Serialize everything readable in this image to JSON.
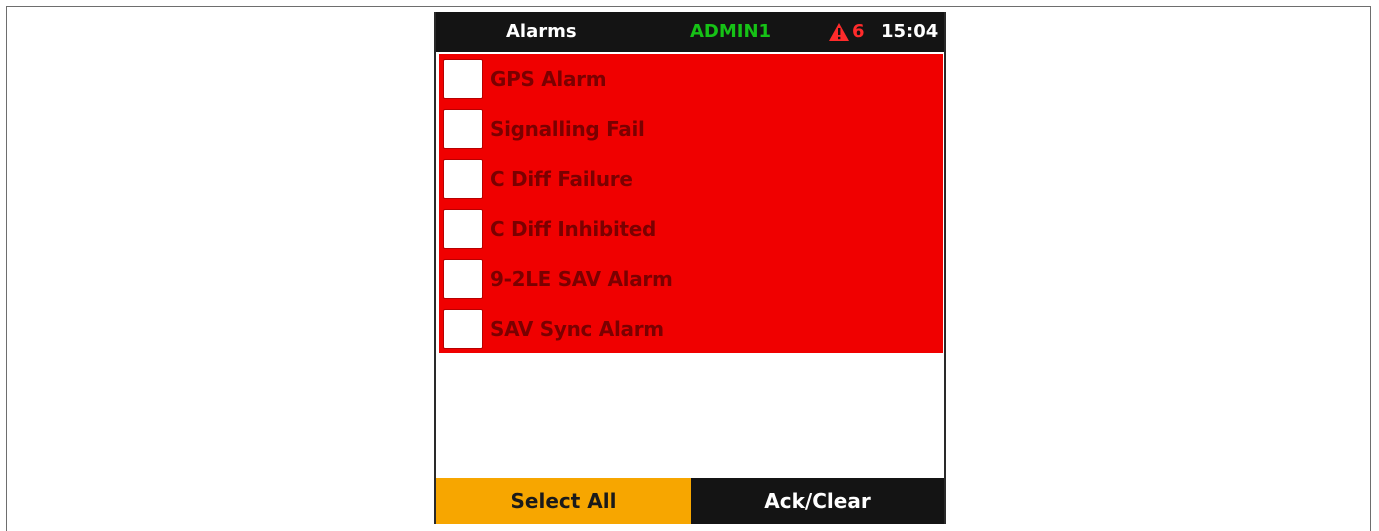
{
  "statusbar": {
    "title": "Alarms",
    "user": "ADMIN1",
    "alarm_icon": "warning-triangle-icon",
    "alarm_count": "6",
    "time": "15:04"
  },
  "alarms": [
    {
      "label": "GPS Alarm",
      "checked": false
    },
    {
      "label": "Signalling Fail",
      "checked": false
    },
    {
      "label": "C Diff Failure",
      "checked": false
    },
    {
      "label": "C Diff Inhibited",
      "checked": false
    },
    {
      "label": "9-2LE SAV Alarm",
      "checked": false
    },
    {
      "label": "SAV Sync Alarm",
      "checked": false
    }
  ],
  "softkeys": {
    "left_label": "Select All",
    "right_label": "Ack/Clear"
  },
  "colors": {
    "alarm_background": "#f00000",
    "alarm_text": "#7a0000",
    "user_text": "#16c216",
    "alarm_count_text": "#ff2b2b",
    "select_all_background": "#f7a600",
    "bar_background": "#141414"
  }
}
